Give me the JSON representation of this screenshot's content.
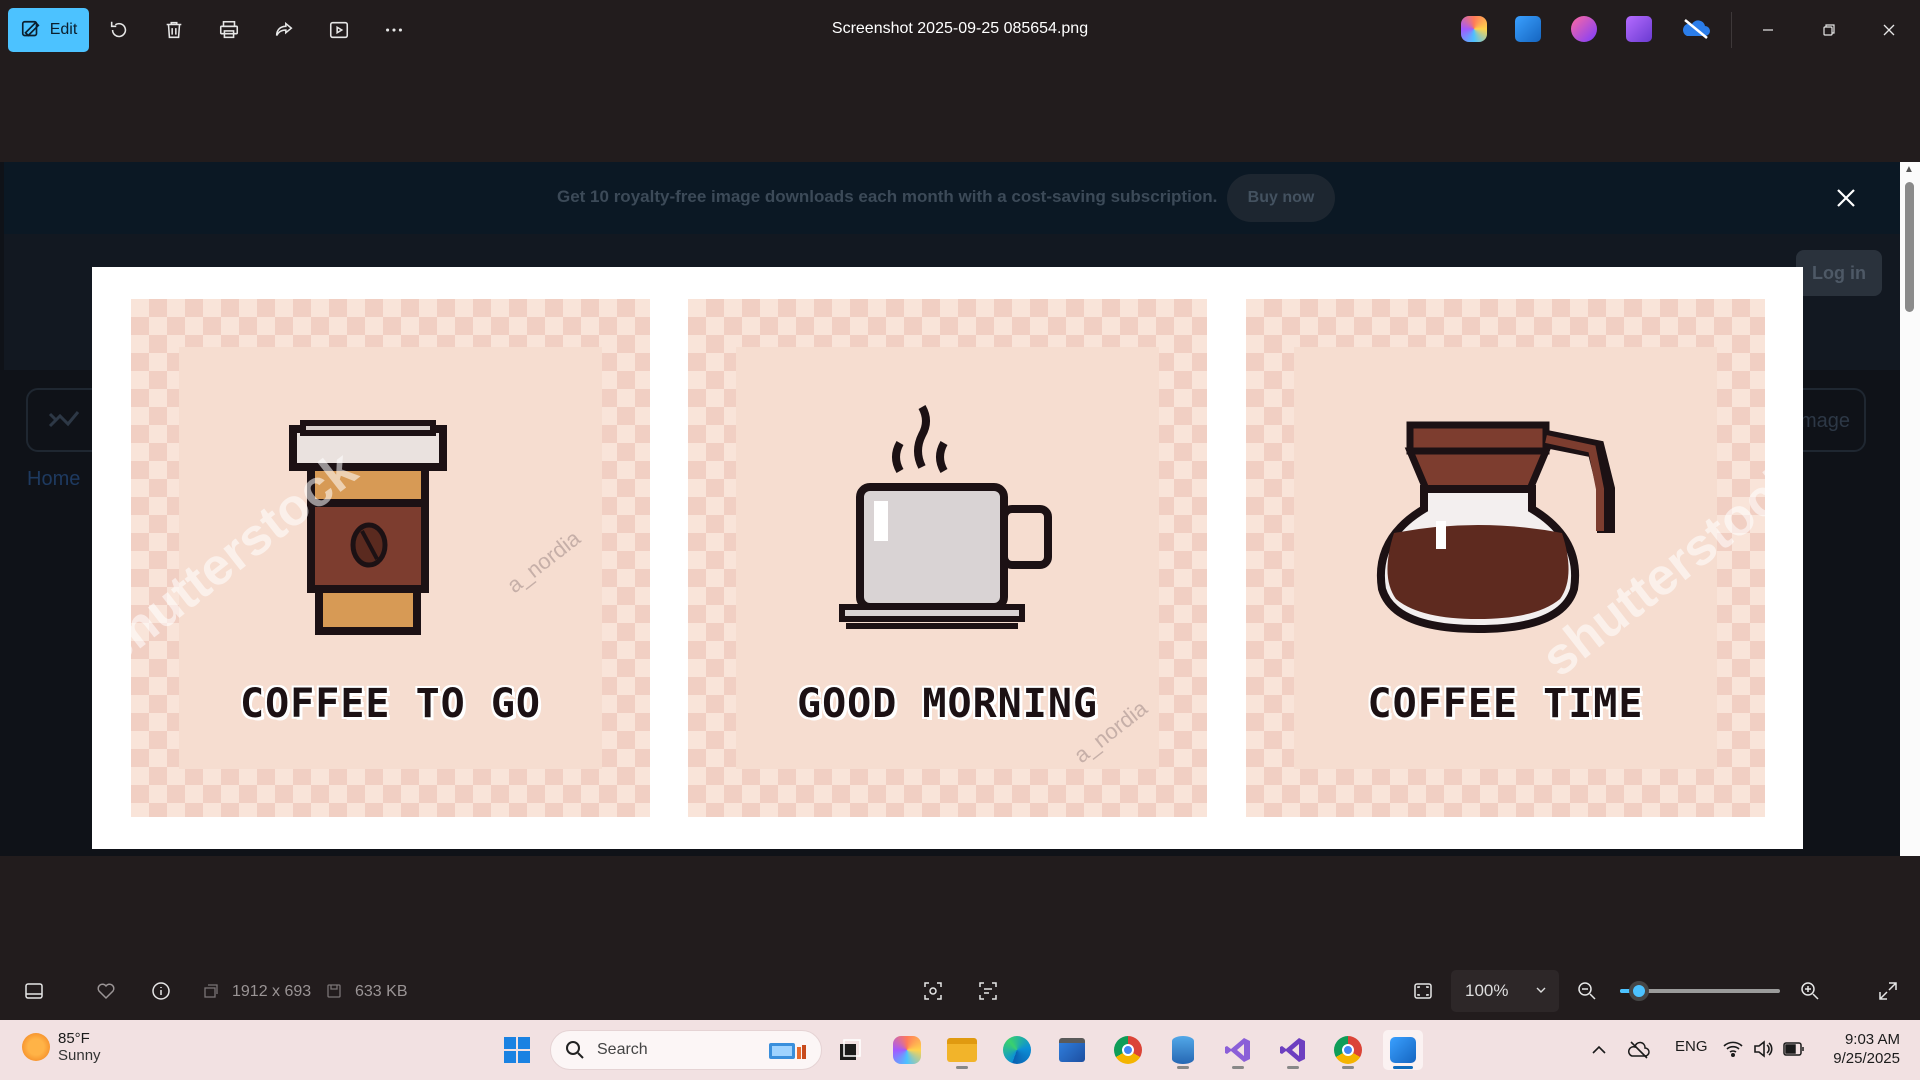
{
  "app": {
    "title": "Screenshot 2025-09-25 085654.png",
    "edit_label": "Edit",
    "accent": "#4cc2ff"
  },
  "toolbar_icons": [
    "rotate-icon",
    "delete-icon",
    "print-icon",
    "share-icon",
    "slideshow-icon",
    "more-icon"
  ],
  "content": {
    "banner_text": "Get 10 royalty-free image downloads each month with a cost-saving subscription.",
    "buy_label": "Buy now",
    "login_label": "Log in",
    "home_label": "Home",
    "image_label": "mage",
    "panels": [
      {
        "label": "COFFEE TO GO",
        "art": "coffee-to-go-cup"
      },
      {
        "label": "GOOD MORNING",
        "art": "steaming-coffee-mug"
      },
      {
        "label": "COFFEE TIME",
        "art": "coffee-pot"
      }
    ],
    "watermarks": [
      "shutterstock",
      "a_nordia"
    ]
  },
  "status": {
    "dimensions": "1912 x 693",
    "size": "633 KB",
    "zoom": "100%",
    "zoom_level": 0.12
  },
  "taskbar": {
    "temp": "85°F",
    "condition": "Sunny",
    "search_placeholder": "Search",
    "language": "ENG",
    "time": "9:03 AM",
    "date": "9/25/2025"
  }
}
